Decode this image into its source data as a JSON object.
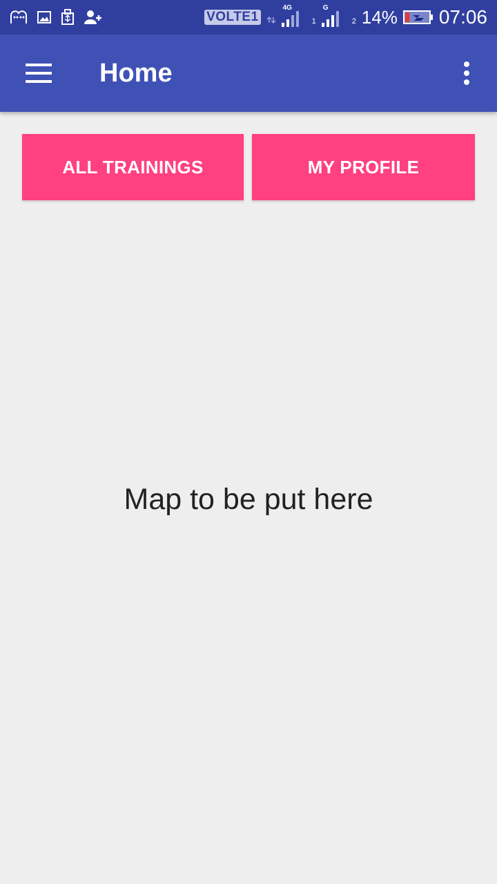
{
  "status_bar": {
    "left_icons": [
      "notification-app-icon",
      "image-icon",
      "usb-icon",
      "add-contact-icon"
    ],
    "volte_label": "VOLTE",
    "volte_sim": "1",
    "sim1_network": "4G",
    "sim1_number": "1",
    "sim2_network": "G",
    "sim2_number": "2",
    "battery_percent": "14%",
    "battery_icon": "battery-charging-icon",
    "time": "07:06"
  },
  "app_bar": {
    "title": "Home",
    "menu_icon": "hamburger-menu-icon",
    "overflow_icon": "more-vert-icon"
  },
  "actions": {
    "all_trainings_label": "ALL TRAININGS",
    "my_profile_label": "MY PROFILE"
  },
  "main": {
    "map_placeholder": "Map to be put here"
  },
  "colors": {
    "status_bar": "#303f9f",
    "app_bar": "#3f51b5",
    "accent": "#ff4081",
    "background": "#eeeeee",
    "text": "#212121"
  }
}
